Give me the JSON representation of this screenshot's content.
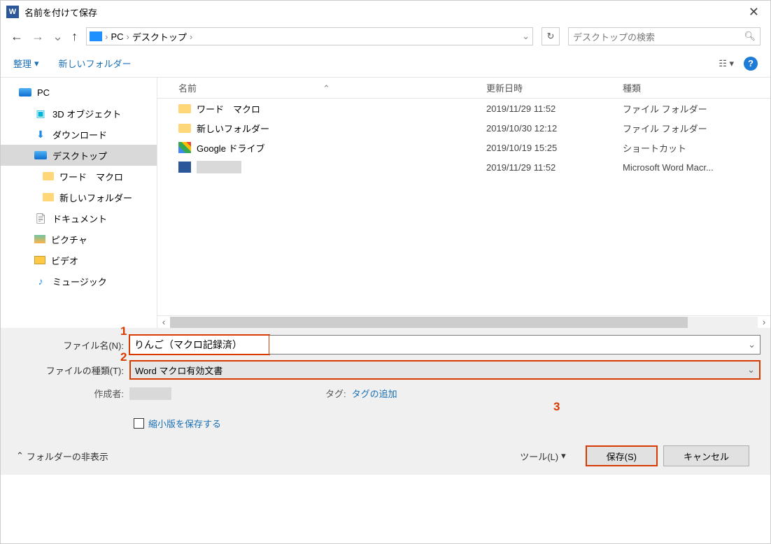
{
  "window": {
    "title": "名前を付けて保存"
  },
  "path": {
    "segments": [
      "PC",
      "デスクトップ"
    ]
  },
  "search": {
    "placeholder": "デスクトップの検索"
  },
  "toolbar": {
    "organize": "整理",
    "newFolder": "新しいフォルダー"
  },
  "sidebar": {
    "items": [
      {
        "label": "PC",
        "icon": "pc",
        "cls": ""
      },
      {
        "label": "3D オブジェクト",
        "icon": "obj3d",
        "cls": "sub"
      },
      {
        "label": "ダウンロード",
        "icon": "dl",
        "cls": "sub"
      },
      {
        "label": "デスクトップ",
        "icon": "pc",
        "cls": "sub selected"
      },
      {
        "label": "ワード　マクロ",
        "icon": "fld",
        "cls": "sub2"
      },
      {
        "label": "新しいフォルダー",
        "icon": "fld",
        "cls": "sub2"
      },
      {
        "label": "ドキュメント",
        "icon": "docs",
        "cls": "sub"
      },
      {
        "label": "ピクチャ",
        "icon": "pic",
        "cls": "sub"
      },
      {
        "label": "ビデオ",
        "icon": "vid",
        "cls": "sub"
      },
      {
        "label": "ミュージック",
        "icon": "mus",
        "cls": "sub"
      }
    ]
  },
  "columns": {
    "name": "名前",
    "date": "更新日時",
    "type": "種類"
  },
  "files": [
    {
      "name": "ワード　マクロ",
      "date": "2019/11/29 11:52",
      "type": "ファイル フォルダー",
      "icon": "folder"
    },
    {
      "name": "新しいフォルダー",
      "date": "2019/10/30 12:12",
      "type": "ファイル フォルダー",
      "icon": "folder"
    },
    {
      "name": "Google ドライブ",
      "date": "2019/10/19 15:25",
      "type": "ショートカット",
      "icon": "shortcut"
    },
    {
      "name": "",
      "date": "2019/11/29 11:52",
      "type": "Microsoft Word Macr...",
      "icon": "word",
      "redacted": true
    }
  ],
  "filenameLabel": "ファイル名(N):",
  "filename": "りんご（マクロ記録済）",
  "filetypeLabel": "ファイルの種類(T):",
  "filetype": "Word マクロ有効文書",
  "authorLabel": "作成者:",
  "tagLabel": "タグ:",
  "tagLink": "タグの追加",
  "thumbnail": "縮小版を保存する",
  "hideFolders": "フォルダーの非表示",
  "toolsMenu": "ツール(L)",
  "saveBtn": "保存(S)",
  "cancelBtn": "キャンセル",
  "callouts": {
    "c1": "1",
    "c2": "2",
    "c3": "3"
  }
}
